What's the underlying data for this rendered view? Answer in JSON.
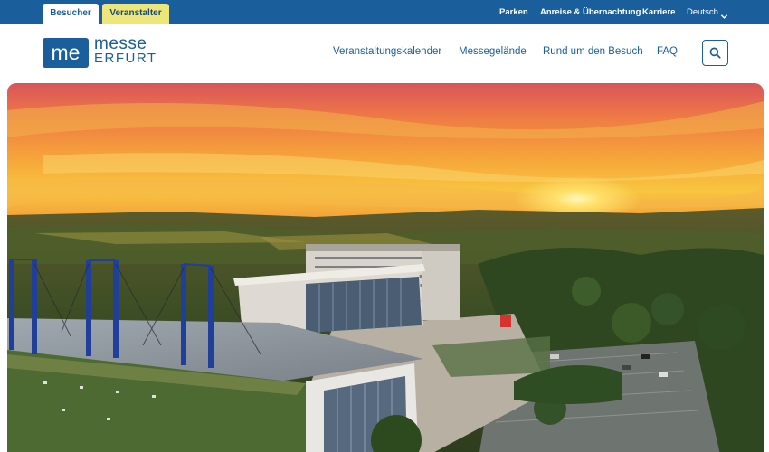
{
  "audience_tabs": {
    "visitor": "Besucher",
    "organizer": "Veranstalter"
  },
  "utility_nav": {
    "parking": "Parken",
    "travel": "Anreise & Übernachtung",
    "career": "Karriere",
    "language": "Deutsch"
  },
  "logo": {
    "mark": "me",
    "line1": "messe",
    "line2": "ERFURT"
  },
  "main_nav": {
    "calendar": "Veranstaltungskalender",
    "grounds": "Messegelände",
    "visit": "Rund um den Besuch",
    "faq": "FAQ"
  },
  "icons": {
    "search": "search-icon",
    "language_dropdown": "chevron-down-icon"
  },
  "colors": {
    "brand_blue": "#1a5e9c",
    "organizer_tab_yellow": "#ede67a",
    "sunset_orange": "#f59a2e"
  }
}
